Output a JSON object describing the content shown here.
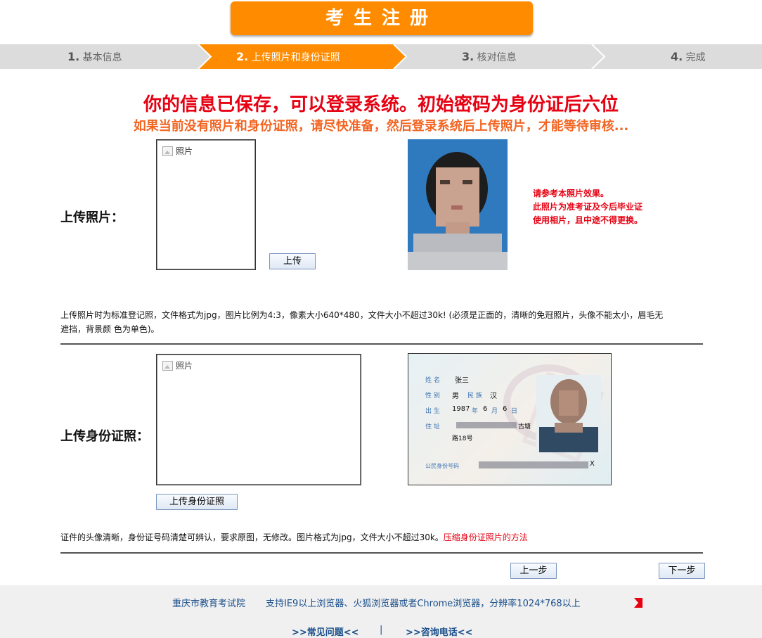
{
  "page": {
    "title": "考生注册"
  },
  "steps": [
    {
      "num": "1.",
      "label": "基本信息"
    },
    {
      "num": "2.",
      "label": "上传照片和身份证照"
    },
    {
      "num": "3.",
      "label": "核对信息"
    },
    {
      "num": "4.",
      "label": "完成"
    }
  ],
  "messages": {
    "headline": "你的信息已保存，可以登录系统。初始密码为身份证后六位",
    "subline": "如果当前没有照片和身份证照，请尽快准备，然后登录系统后上传照片，才能等待审核..."
  },
  "photo_section": {
    "label": "上传照片：",
    "preview_alt": "照片",
    "upload_button": "上传",
    "sample_note": [
      "请参考本照片效果。",
      "此照片为准考证及今后毕业证",
      "使用相片，且中途不得更换。"
    ],
    "description": "上传照片时为标准登记照，文件格式为jpg，图片比例为4:3，像素大小640*480，文件大小不超过30k! (必须是正面的，清晰的免冠照片，头像不能太小，眉毛无遮挡，背景颜 色为单色)。"
  },
  "id_section": {
    "label": "上传身份证照：",
    "preview_alt": "照片",
    "upload_button": "上传身份证照",
    "card": {
      "name_label": "姓 名",
      "name": "张三",
      "sex_label": "性 别",
      "sex": "男",
      "ethnic_label": "民 族",
      "ethnic": "汉",
      "birth_label": "出 生",
      "birth_year": "1987",
      "year_unit": "年",
      "birth_month": "6",
      "month_unit": "月",
      "birth_day": "6",
      "day_unit": "日",
      "address_label": "住 址",
      "address_line1_tail": "古塘",
      "address_line2": "路18号",
      "id_label": "公民身份号码",
      "id_tail": "X"
    },
    "description": "证件的头像清晰，身份证号码清楚可辨认，要求原图，无修改。图片格式为jpg，文件大小不超过30k。",
    "compress_link": "压缩身份证照片的方法"
  },
  "nav": {
    "prev": "上一步",
    "next": "下一步"
  },
  "footer": {
    "org": "重庆市教育考试院",
    "browser_note": "支持IE9以上浏览器、火狐浏览器或者Chrome浏览器，分辨率1024*768以上",
    "faq": ">>常见问题<<",
    "separator": "|",
    "contact": ">>咨询电话<<"
  },
  "colors": {
    "accent": "#ff8c00",
    "alert": "#e60012",
    "link": "#1a4f8a"
  }
}
